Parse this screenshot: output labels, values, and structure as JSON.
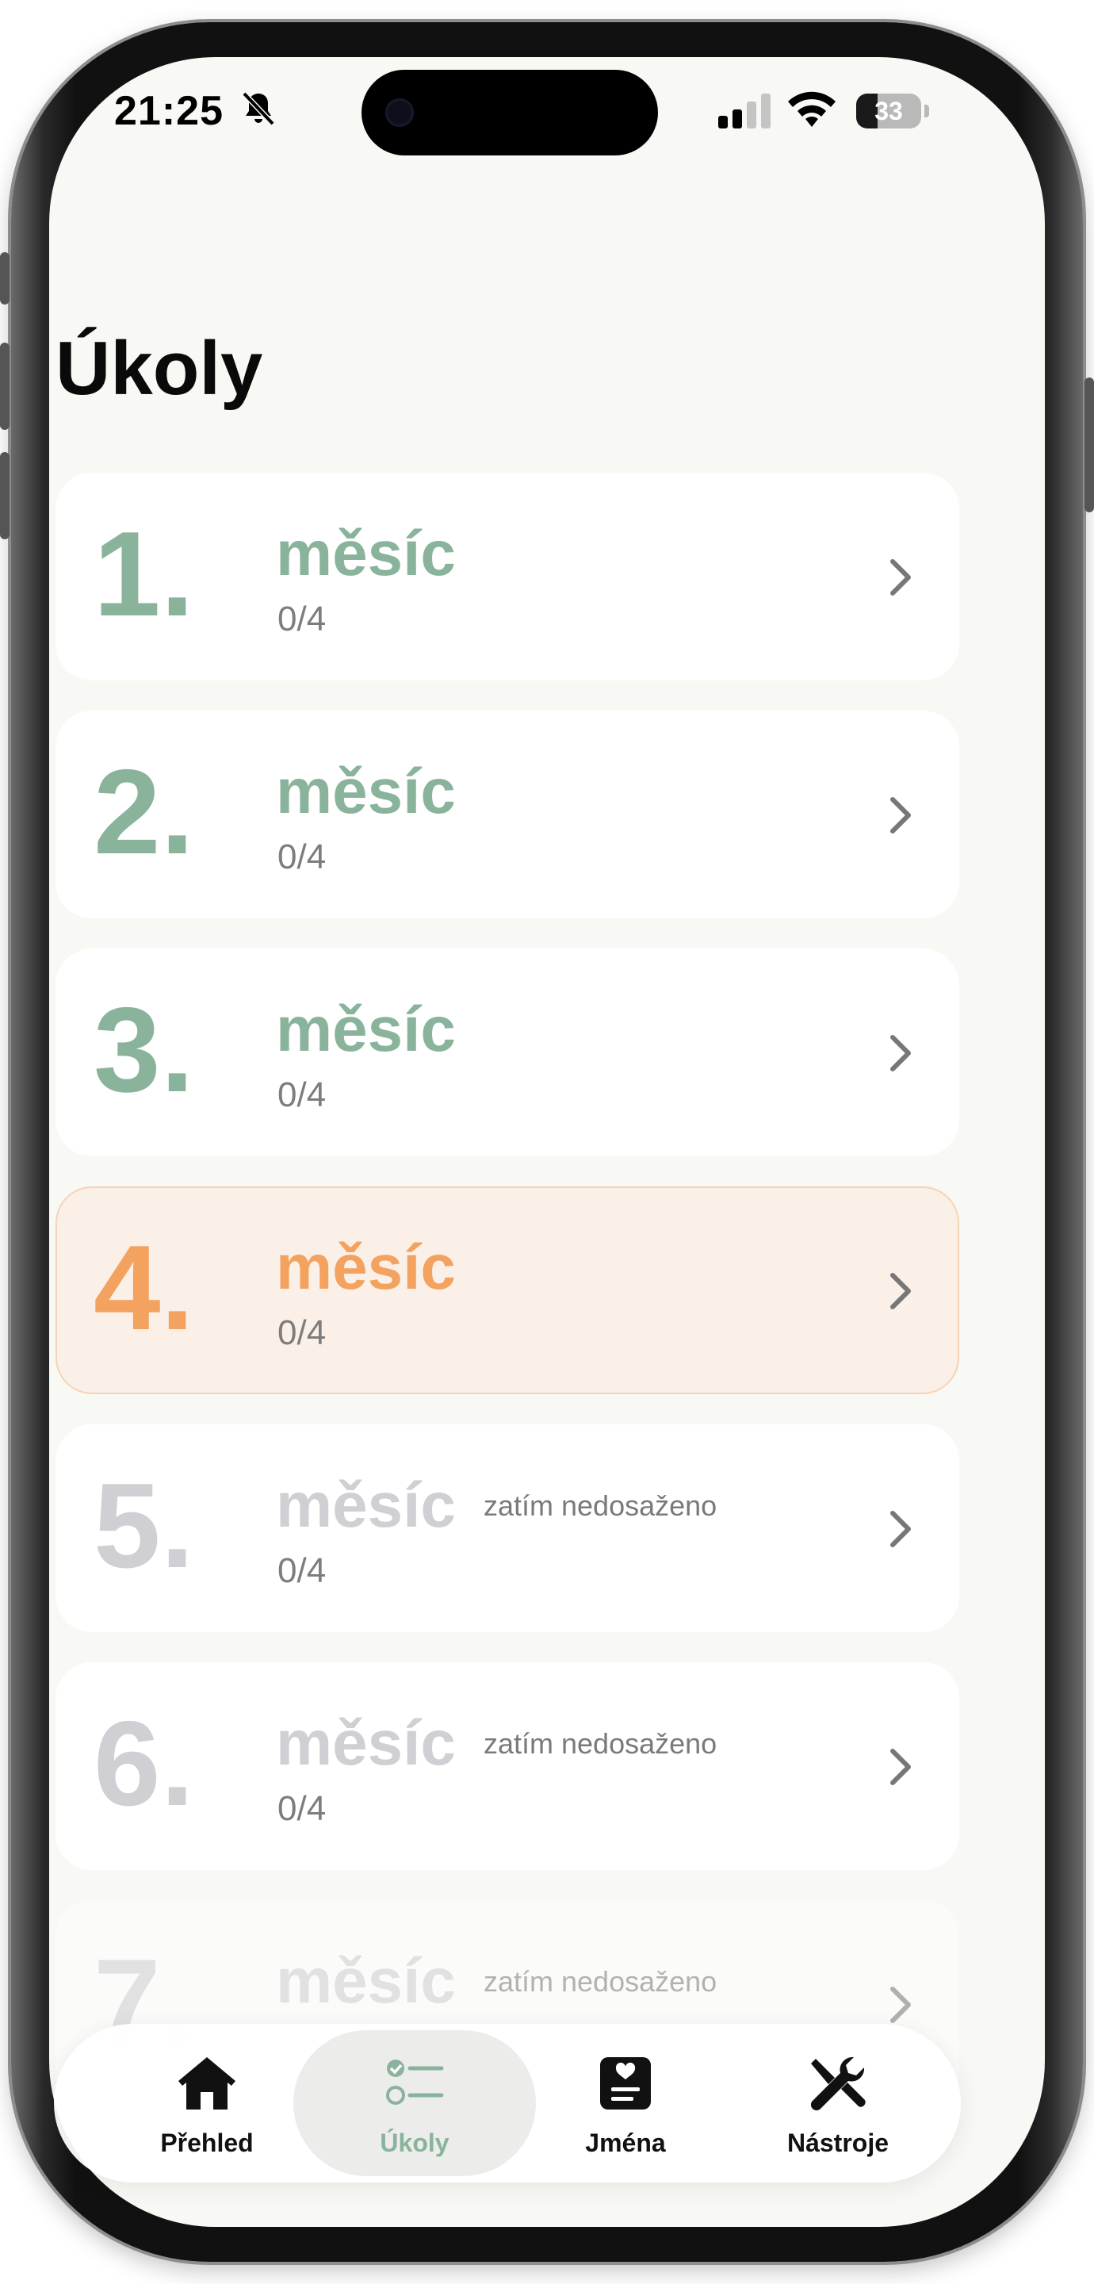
{
  "status_bar": {
    "time": "21:25",
    "battery": "33",
    "battery_level": 0.33
  },
  "page": {
    "title": "Úkoly"
  },
  "months": [
    {
      "number": "1.",
      "title": "měsíc",
      "progress": "0/4",
      "note": "",
      "state": "completed"
    },
    {
      "number": "2.",
      "title": "měsíc",
      "progress": "0/4",
      "note": "",
      "state": "completed"
    },
    {
      "number": "3.",
      "title": "měsíc",
      "progress": "0/4",
      "note": "",
      "state": "completed"
    },
    {
      "number": "4.",
      "title": "měsíc",
      "progress": "0/4",
      "note": "",
      "state": "current"
    },
    {
      "number": "5.",
      "title": "měsíc",
      "progress": "0/4",
      "note": "zatím nedosaženo",
      "state": "locked"
    },
    {
      "number": "6.",
      "title": "měsíc",
      "progress": "0/4",
      "note": "zatím nedosaženo",
      "state": "locked"
    },
    {
      "number": "7.",
      "title": "měsíc",
      "progress": "",
      "note": "zatím nedosaženo",
      "state": "locked"
    }
  ],
  "tabs": [
    {
      "label": "Přehled",
      "icon": "house-icon",
      "active": false
    },
    {
      "label": "Úkoly",
      "icon": "checklist-icon",
      "active": true
    },
    {
      "label": "Jména",
      "icon": "name-card-icon",
      "active": false
    },
    {
      "label": "Nástroje",
      "icon": "tools-icon",
      "active": false
    }
  ],
  "colors": {
    "completed": "#8ab39c",
    "current": "#f3a260",
    "locked": "#cfcfd4",
    "background": "#f8f8f5"
  }
}
